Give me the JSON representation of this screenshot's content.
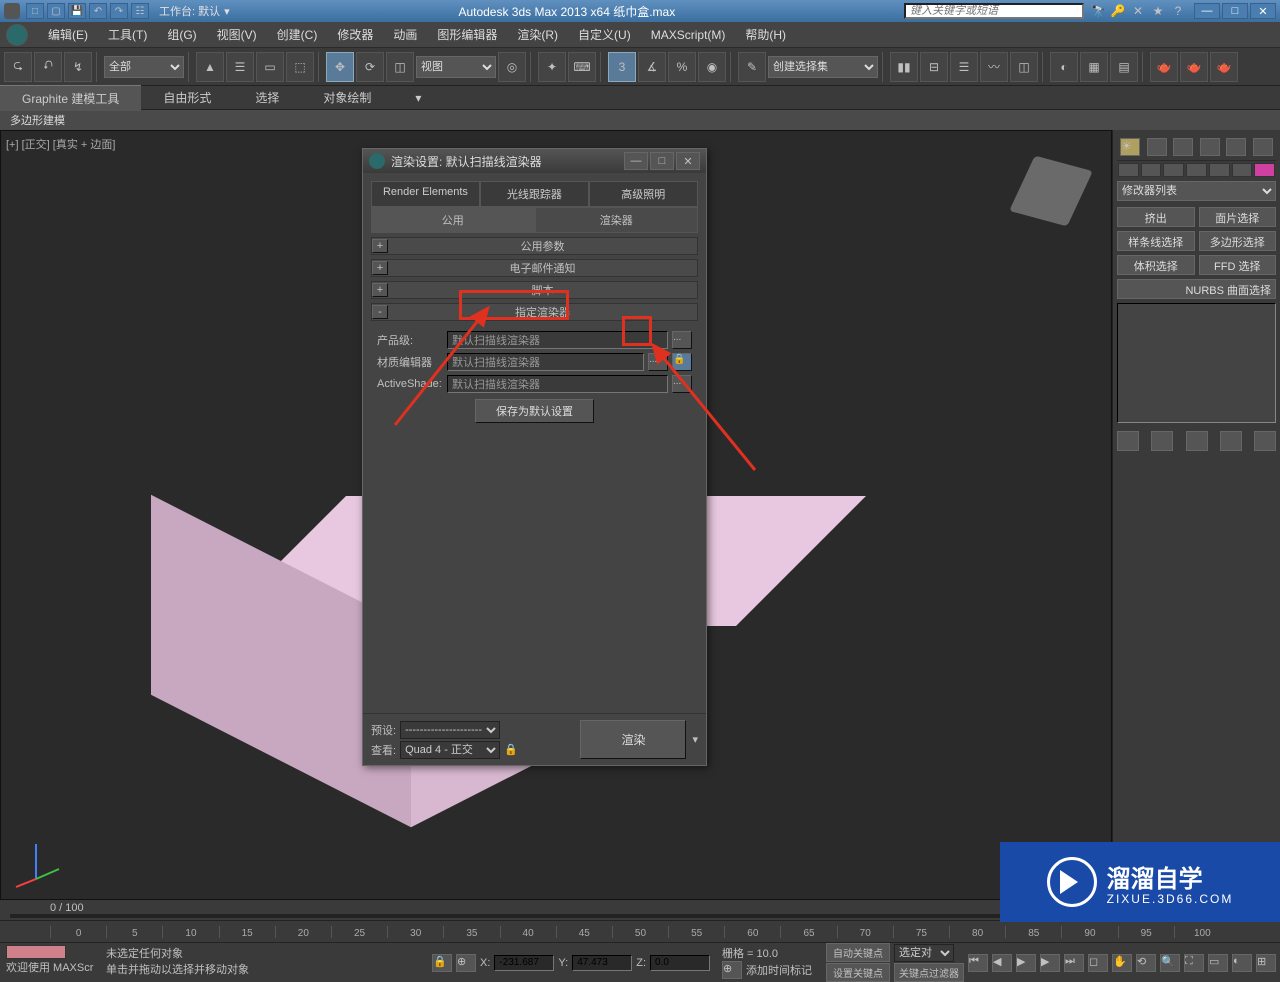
{
  "titlebar": {
    "workspace_label": "工作台: 默认",
    "title": "Autodesk 3ds Max  2013 x64    纸巾盒.max",
    "search_placeholder": "键入关键字或短语"
  },
  "menu": [
    "编辑(E)",
    "工具(T)",
    "组(G)",
    "视图(V)",
    "创建(C)",
    "修改器",
    "动画",
    "图形编辑器",
    "渲染(R)",
    "自定义(U)",
    "MAXScript(M)",
    "帮助(H)"
  ],
  "toolbar": {
    "filter": "全部",
    "view": "视图",
    "selset_placeholder": "创建选择集"
  },
  "ribbon": {
    "tabs": [
      "Graphite 建模工具",
      "自由形式",
      "选择",
      "对象绘制"
    ],
    "sub": "多边形建模"
  },
  "viewport": {
    "label": "[+] [正交] [真实 + 边面]"
  },
  "right_panel": {
    "modlist": "修改器列表",
    "btns": [
      "挤出",
      "面片选择",
      "样条线选择",
      "多边形选择",
      "体积选择",
      "FFD 选择"
    ],
    "nurbs": "NURBS 曲面选择"
  },
  "dialog": {
    "title": "渲染设置: 默认扫描线渲染器",
    "tabs1": [
      "Render Elements",
      "光线跟踪器",
      "高级照明"
    ],
    "tabs2": [
      "公用",
      "渲染器"
    ],
    "rollouts": [
      "公用参数",
      "电子邮件通知",
      "脚本",
      "指定渲染器"
    ],
    "rows": {
      "prod_label": "产品级:",
      "mat_label": "材质编辑器",
      "as_label": "ActiveShade:",
      "default_renderer": "默认扫描线渲染器"
    },
    "save_btn": "保存为默认设置",
    "preset_label": "预设:",
    "preset_value": "---------------------",
    "view_label": "查看:",
    "view_value": "Quad 4 - 正交",
    "render_btn": "渲染"
  },
  "timeline": {
    "label": "0 / 100",
    "ticks": [
      "0",
      "5",
      "10",
      "15",
      "20",
      "25",
      "30",
      "35",
      "40",
      "45",
      "50",
      "55",
      "60",
      "65",
      "70",
      "75",
      "80",
      "85",
      "90",
      "95",
      "100"
    ]
  },
  "status": {
    "welcome": "欢迎使用  MAXScr",
    "noselect": "未选定任何对象",
    "hint": "单击并拖动以选择并移动对象",
    "x_label": "X:",
    "x_val": "-231.687",
    "y_label": "Y:",
    "y_val": "47.473",
    "z_label": "Z:",
    "z_val": "0.0",
    "grid": "栅格 = 10.0",
    "addtime": "添加时间标记",
    "autokey": "自动关键点",
    "setkey": "设置关键点",
    "selbind": "选定对",
    "keyfilter": "关键点过滤器"
  },
  "watermark": {
    "big": "溜溜自学",
    "small": "ZIXUE.3D66.COM"
  }
}
